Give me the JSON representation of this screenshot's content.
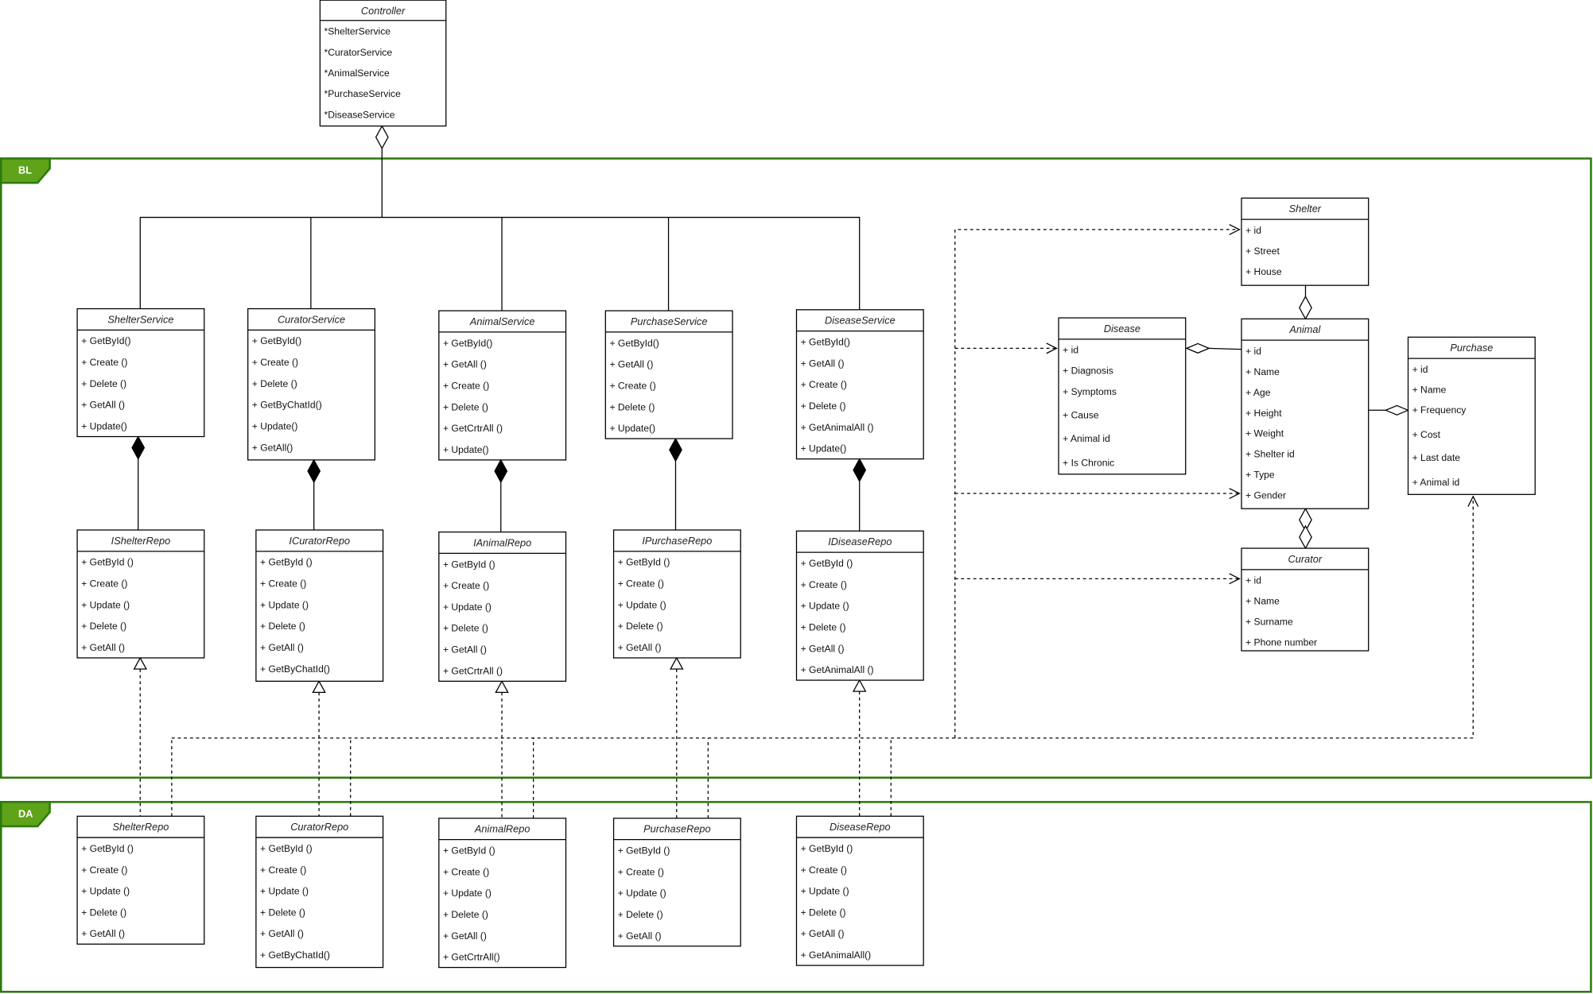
{
  "frames": [
    {
      "label": "BL",
      "color": "#2d7a0e",
      "tab_color": "#5ea319"
    },
    {
      "label": "DA",
      "color": "#2d7a0e",
      "tab_color": "#5ea319"
    }
  ],
  "classes": {
    "controller": {
      "name": "Controller",
      "members": [
        "*ShelterService",
        "*CuratorService",
        "*AnimalService",
        "*PurchaseService",
        "*DiseaseService"
      ]
    },
    "shelter_service": {
      "name": "ShelterService",
      "members": [
        "+ GetById()",
        "+ Create ()",
        "+ Delete ()",
        "+ GetAll ()",
        "+ Update()"
      ]
    },
    "curator_service": {
      "name": "CuratorService",
      "members": [
        "+ GetById()",
        "+ Create ()",
        "+ Delete ()",
        "+ GetByChatId()",
        "+ Update()",
        "+ GetAll()"
      ]
    },
    "animal_service": {
      "name": "AnimalService",
      "members": [
        "+ GetById()",
        "+ GetAll ()",
        "+ Create ()",
        "+ Delete ()",
        "+ GetCrtrAll ()",
        "+ Update()"
      ]
    },
    "purchase_service": {
      "name": "PurchaseService",
      "members": [
        "+ GetById()",
        "+ GetAll ()",
        "+ Create ()",
        "+ Delete ()",
        "+ Update()"
      ]
    },
    "disease_service": {
      "name": "DiseaseService",
      "members": [
        "+ GetById()",
        "+ GetAll ()",
        "+ Create ()",
        "+ Delete ()",
        "+ GetAnimalAll ()",
        "+ Update()"
      ]
    },
    "ishelter_repo": {
      "name": "IShelterRepo",
      "members": [
        "+ GetById ()",
        "+ Create ()",
        "+ Update ()",
        "+ Delete ()",
        "+ GetAll ()"
      ]
    },
    "icurator_repo": {
      "name": "ICuratorRepo",
      "members": [
        "+ GetById ()",
        "+ Create ()",
        "+ Update ()",
        "+ Delete ()",
        "+ GetAll ()",
        "+ GetByChatId()"
      ]
    },
    "ianimal_repo": {
      "name": "IAnimalRepo",
      "members": [
        "+ GetById ()",
        "+ Create ()",
        "+ Update ()",
        "+ Delete ()",
        "+ GetAll ()",
        "+ GetCrtrAll ()"
      ]
    },
    "ipurchase_repo": {
      "name": "IPurchaseRepo",
      "members": [
        "+ GetById ()",
        "+ Create ()",
        "+ Update ()",
        "+ Delete ()",
        "+ GetAll ()"
      ]
    },
    "idisease_repo": {
      "name": "IDiseaseRepo",
      "members": [
        "+ GetById ()",
        "+ Create ()",
        "+ Update ()",
        "+ Delete ()",
        "+ GetAll ()",
        "+ GetAnimalAll ()"
      ]
    },
    "shelter": {
      "name": "Shelter",
      "members": [
        "+ id",
        "+ Street",
        "+ House"
      ]
    },
    "disease": {
      "name": "Disease",
      "members": [
        "+ id",
        "+ Diagnosis",
        "+ Symptoms",
        "+ Cause",
        "+ Animal id",
        "+ Is Chronic"
      ]
    },
    "animal": {
      "name": "Animal",
      "members": [
        "+ id",
        "+ Name",
        "+ Age",
        "+ Height",
        "+ Weight",
        "+ Shelter id",
        "+ Type",
        "+ Gender"
      ]
    },
    "purchase": {
      "name": "Purchase",
      "members": [
        "+ id",
        "+ Name",
        "+ Frequency",
        "+ Cost",
        "+ Last date",
        "+ Animal id"
      ]
    },
    "curator": {
      "name": "Curator",
      "members": [
        "+ id",
        "+ Name",
        "+ Surname",
        "+ Phone number"
      ]
    },
    "shelter_repo": {
      "name": "ShelterRepo",
      "members": [
        "+ GetById ()",
        "+ Create ()",
        "+ Update ()",
        "+ Delete ()",
        "+ GetAll ()"
      ]
    },
    "curator_repo": {
      "name": "CuratorRepo",
      "members": [
        "+ GetById ()",
        "+ Create ()",
        "+ Update ()",
        "+ Delete ()",
        "+ GetAll ()",
        "+ GetByChatId()"
      ]
    },
    "animal_repo": {
      "name": "AnimalRepo",
      "members": [
        "+ GetById ()",
        "+ Create ()",
        "+ Update ()",
        "+ Delete ()",
        "+ GetAll ()",
        "+ GetCrtrAll()"
      ]
    },
    "purchase_repo": {
      "name": "PurchaseRepo",
      "members": [
        "+ GetById ()",
        "+ Create ()",
        "+ Update ()",
        "+ Delete ()",
        "+ GetAll ()"
      ]
    },
    "disease_repo": {
      "name": "DiseaseRepo",
      "members": [
        "+ GetById ()",
        "+ Create ()",
        "+ Update ()",
        "+ Delete ()",
        "+ GetAll ()",
        "+ GetAnimalAll()"
      ]
    }
  }
}
